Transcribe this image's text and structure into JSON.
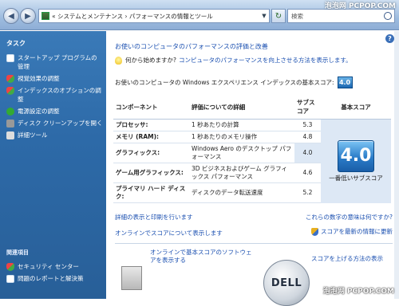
{
  "titlebar": {
    "address_text": "« システムとメンテナンス › パフォーマンスの情報とツール",
    "search_placeholder": "検索",
    "watermark": "泡泡网 PCPOP.COM"
  },
  "sidebar": {
    "tasks_heading": "タスク",
    "items": [
      {
        "label": "スタートアップ プログラムの管理",
        "icon": "startup-icon"
      },
      {
        "label": "視覚効果の調整",
        "icon": "shield-icon"
      },
      {
        "label": "インデックスのオプションの調整",
        "icon": "index-icon"
      },
      {
        "label": "電源設定の調整",
        "icon": "power-icon"
      },
      {
        "label": "ディスク クリーンアップを開く",
        "icon": "disk-icon"
      },
      {
        "label": "詳細ツール",
        "icon": "tools-icon"
      }
    ],
    "related_heading": "関連項目",
    "related": [
      {
        "label": "セキュリティ センター",
        "icon": "security-icon"
      },
      {
        "label": "問題のレポートと解決策",
        "icon": "report-icon"
      }
    ]
  },
  "main": {
    "title": "お使いのコンピュータのパフォーマンスの評価と改善",
    "hint_prefix": "何から始めますか?",
    "hint_link": "コンピュータのパフォーマンスを向上させる方法を表示します。",
    "base_label": "お使いのコンピュータの Windows エクスペリエンス インデックスの基本スコア:",
    "base_score": "4.0",
    "table": {
      "headers": [
        "コンポーネント",
        "評価についての詳細",
        "サブスコア",
        "基本スコア"
      ],
      "rows": [
        {
          "component": "プロセッサ:",
          "detail": "1 秒あたりの計算",
          "subscore": "5.3"
        },
        {
          "component": "メモリ (RAM):",
          "detail": "1 秒あたりのメモリ操作",
          "subscore": "4.8"
        },
        {
          "component": "グラフィックス:",
          "detail": "Windows Aero のデスクトップ パフォーマンス",
          "subscore": "4.0"
        },
        {
          "component": "ゲーム用グラフィックス:",
          "detail": "3D ビジネスおよびゲーム グラフィックス パフォーマンス",
          "subscore": "4.6"
        },
        {
          "component": "プライマリ ハード ディスク:",
          "detail": "ディスクのデータ転送速度",
          "subscore": "5.2"
        }
      ],
      "base_score_big": "4.0",
      "base_score_caption": "一番低いサブスコア"
    },
    "link_details": "詳細の表示と印刷を行います",
    "link_meaning": "これらの数字の意味は何ですか?",
    "link_online": "オンラインでスコアについて表示します",
    "link_refresh": "スコアを最新の情報に更新",
    "promo_left": "オンラインで基本スコアのソフトウェアを表示する",
    "promo_right": "スコアを上げる方法の表示",
    "dell_logo": "DELL",
    "help": "?"
  },
  "watermark_bottom": "泡泡网 PCPOP.COM"
}
